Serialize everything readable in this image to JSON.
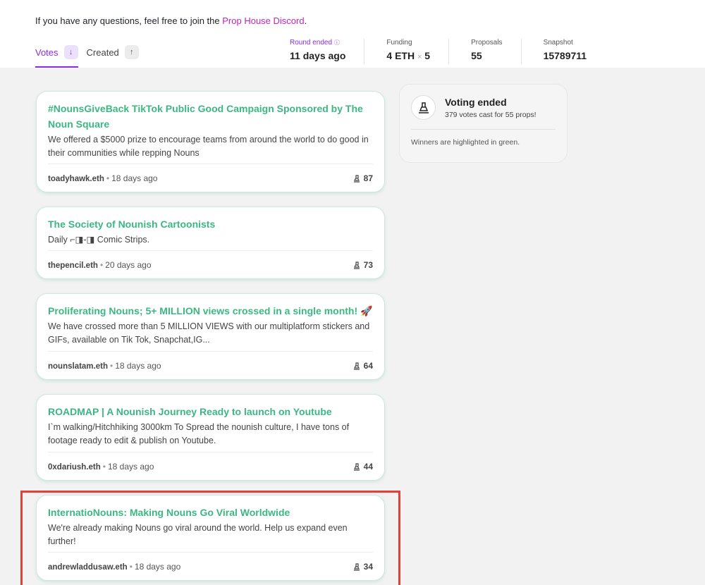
{
  "header": {
    "intro_text": "If you have any questions, feel free to join the",
    "discord_link": "Prop House Discord",
    "intro_suffix": "."
  },
  "tabs": [
    {
      "label": "Votes",
      "icon": "arrow-down-icon",
      "active": true
    },
    {
      "label": "Created",
      "icon": "arrow-up-icon",
      "active": false
    }
  ],
  "stats": {
    "round": {
      "label": "Round ended",
      "value": "11 days ago"
    },
    "funding": {
      "label": "Funding",
      "amount": "4 ETH",
      "times": "×",
      "count": "5"
    },
    "proposals": {
      "label": "Proposals",
      "value": "55"
    },
    "snapshot": {
      "label": "Snapshot",
      "value": "15789711"
    }
  },
  "proposals": [
    {
      "title": "#NounsGiveBack TikTok Public Good Campaign Sponsored by The Noun Square",
      "description": "We offered a $5000 prize to encourage teams from around the world to do good in their communities while repping Nouns",
      "author": "toadyhawk.eth",
      "date": "18 days ago",
      "votes": "87"
    },
    {
      "title": "The Society of Nounish Cartoonists",
      "description": "Daily ⌐◨-◨ Comic Strips.",
      "author": "thepencil.eth",
      "date": "20 days ago",
      "votes": "73"
    },
    {
      "title": "Proliferating Nouns; 5+ MILLION views crossed in a single month! 🚀",
      "description": "We have crossed more than 5 MILLION VIEWS with our multiplatform stickers and GIFs, available on Tik Tok, Snapchat,IG...",
      "author": "nounslatam.eth",
      "date": "18 days ago",
      "votes": "64"
    },
    {
      "title": "ROADMAP | A Nounish Journey Ready to launch on Youtube",
      "description": "I`m walking/Hitchhiking 3000km To Spread the nounish culture, I have tons of footage ready to edit & publish on Youtube.",
      "author": "0xdariush.eth",
      "date": "18 days ago",
      "votes": "44"
    },
    {
      "title": "InternatioNouns: Making Nouns Go Viral Worldwide",
      "description": "We're already making Nouns go viral around the world. Help us expand even further!",
      "author": "andrewladdusaw.eth",
      "date": "18 days ago",
      "votes": "34"
    }
  ],
  "sidebar": {
    "title": "Voting ended",
    "subtitle": "379 votes cast for 55 props!",
    "note": "Winners are highlighted in green."
  },
  "colors": {
    "accent": "#8a2be2",
    "link": "#c81fbf",
    "winner_title": "#3cb784",
    "highlight_box": "#e0413a"
  }
}
